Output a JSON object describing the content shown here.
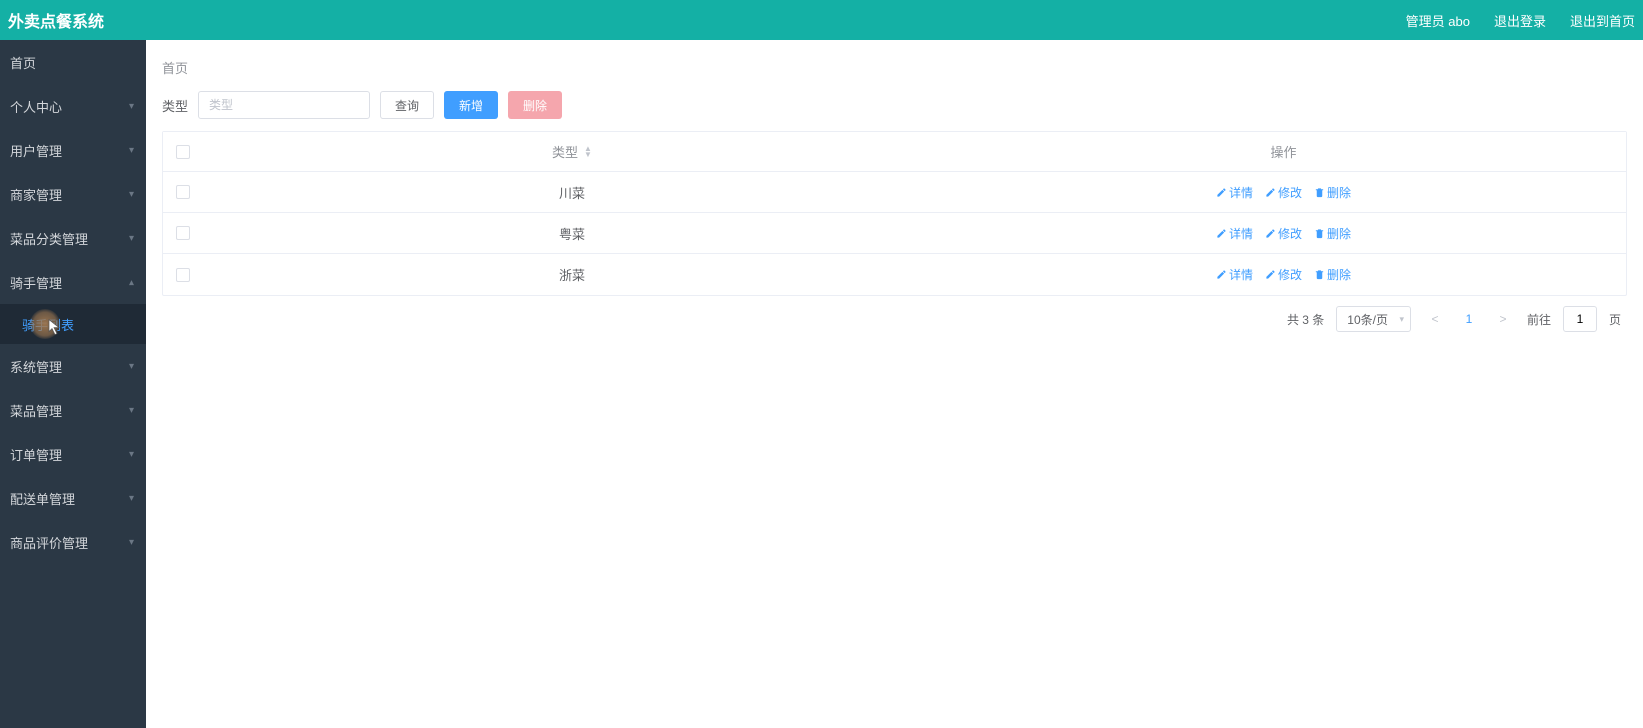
{
  "header": {
    "title": "外卖点餐系统",
    "user": "管理员 abo",
    "logout": "退出登录",
    "exitHome": "退出到首页"
  },
  "sidebar": {
    "items": [
      {
        "label": "首页",
        "expandable": false
      },
      {
        "label": "个人中心",
        "expandable": true
      },
      {
        "label": "用户管理",
        "expandable": true
      },
      {
        "label": "商家管理",
        "expandable": true
      },
      {
        "label": "菜品分类管理",
        "expandable": true
      },
      {
        "label": "骑手管理",
        "expandable": true,
        "open": true,
        "children": [
          {
            "label": "骑手列表"
          }
        ]
      },
      {
        "label": "系统管理",
        "expandable": true
      },
      {
        "label": "菜品管理",
        "expandable": true
      },
      {
        "label": "订单管理",
        "expandable": true
      },
      {
        "label": "配送单管理",
        "expandable": true
      },
      {
        "label": "商品评价管理",
        "expandable": true
      }
    ]
  },
  "breadcrumb": "首页",
  "filter": {
    "label": "类型",
    "placeholder": "类型",
    "searchBtn": "查询",
    "addBtn": "新增",
    "deleteBtn": "删除"
  },
  "table": {
    "columns": {
      "type": "类型",
      "actions": "操作"
    },
    "actions": {
      "detail": "详情",
      "edit": "修改",
      "delete": "删除"
    },
    "rows": [
      {
        "type": "川菜"
      },
      {
        "type": "粤菜"
      },
      {
        "type": "浙菜"
      }
    ]
  },
  "pagination": {
    "total": "共 3 条",
    "pageSize": "10条/页",
    "current": "1",
    "gotoPrefix": "前往",
    "gotoValue": "1",
    "gotoSuffix": "页"
  }
}
